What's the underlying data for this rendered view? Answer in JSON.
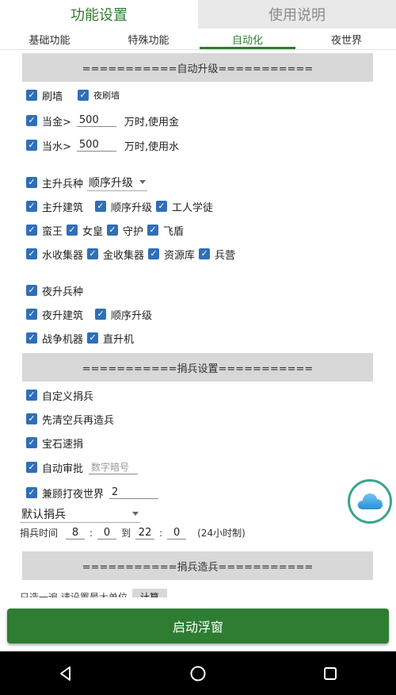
{
  "top_tabs": [
    {
      "label": "功能设置"
    },
    {
      "label": "使用说明"
    }
  ],
  "sub_tabs": [
    {
      "label": "基础功能"
    },
    {
      "label": "特殊功能"
    },
    {
      "label": "自动化"
    },
    {
      "label": "夜世界"
    }
  ],
  "sections": {
    "auto_upgrade": "===========自动升级===========",
    "donate_settings": "===========捐兵设置===========",
    "donate_train": "===========捐兵造兵==========="
  },
  "auto_upgrade": {
    "wall": "刷墙",
    "night_wall": "夜刷墙",
    "gold_prefix": "当金>",
    "gold_value": "500",
    "gold_suffix": "万时,使用金",
    "elixir_prefix": "当水>",
    "elixir_value": "500",
    "elixir_suffix": "万时,使用水",
    "main_troop": "主升兵种",
    "troop_order": "顺序升级",
    "main_building": "主升建筑",
    "building_order": "顺序升级",
    "builder_apprentice": "工人学徒",
    "heroes": [
      "蛮王",
      "女皇",
      "守护",
      "飞盾"
    ],
    "collectors": [
      "水收集器",
      "金收集器",
      "资源库",
      "兵营"
    ],
    "night_troop": "夜升兵种",
    "night_building": "夜升建筑",
    "night_order": "顺序升级",
    "war_machine": "战争机器",
    "helicopter": "直升机"
  },
  "donate": {
    "custom_donate": "自定义捐兵",
    "clear_then_train": "先清空兵再造兵",
    "gem_donate": "宝石速捐",
    "auto_approve": "自动审批",
    "auto_approve_placeholder": "数字暗号",
    "night_world": "兼顾打夜世界",
    "night_world_value": "2",
    "default_select": "默认捐兵",
    "time_label": "捐兵时间",
    "start_h": "8",
    "start_m": "0",
    "to": "到",
    "end_h": "22",
    "end_m": "0",
    "hint": "(24小时制)"
  },
  "partial_row": {
    "text": "只造一遍    请设置最大单位",
    "calc_button": "计算"
  },
  "start_button": "启动浮窗",
  "colors": {
    "accent": "#2e7d32",
    "checkbox": "#2f6fb8",
    "section_bg": "#d8d8d8"
  },
  "icons": {
    "floating": "cloud-icon",
    "nav": [
      "back-icon",
      "home-icon",
      "recents-icon"
    ]
  }
}
